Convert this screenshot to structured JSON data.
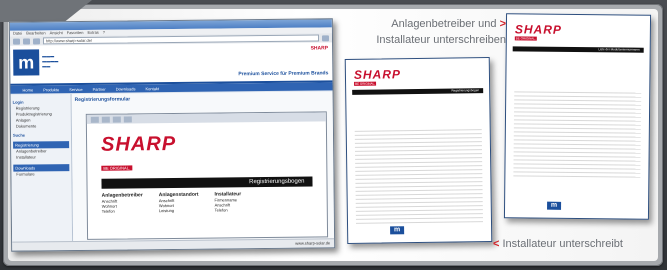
{
  "annotations": {
    "top_line1": "Anlagenbetreiber und",
    "top_arrow": ">",
    "top_line2": "Installateur unterschreiben",
    "bottom_arrow": "<",
    "bottom_text": "Installateur unterschreibt"
  },
  "browser": {
    "menu": [
      "Datei",
      "Bearbeiten",
      "Ansicht",
      "Favoriten",
      "Extras",
      "?"
    ],
    "address": "http://www.sharp-solar.de/",
    "logo_letter": "m",
    "slogan": "Premium Service für Premium Brands",
    "brand_mini": "SHARP",
    "nav": [
      "Home",
      "Produkte",
      "Service",
      "Partner",
      "Downloads",
      "Kontakt"
    ],
    "sidebar": {
      "heading1": "Login",
      "items1": [
        "Registrierung",
        "Produktregistrierung",
        "Anlagen",
        "Dokumente"
      ],
      "heading2": "Suche",
      "box1": "Registrierung",
      "items2": [
        "Anlagenbetreiber",
        "Installateur"
      ],
      "box2": "Downloads",
      "items3": [
        "Formulare"
      ]
    },
    "main_title": "Registrierungsformular",
    "doc": {
      "brand": "SHARP",
      "brand_sub": "BE ORIGINAL.",
      "bar_title": "Registrierungsbogen",
      "col1_head": "Anlagenbetreiber",
      "col1": [
        "Anschrift",
        "Wohnort",
        "Telefon"
      ],
      "col2_head": "Anlagenstandort",
      "col2": [
        "Anschrift",
        "Wohnort",
        "Leistung"
      ],
      "col3_head": "Installateur",
      "col3": [
        "Firmenname",
        "Anschrift",
        "Telefon"
      ]
    },
    "status": "www.sharp-solar.de"
  },
  "page_left": {
    "brand": "SHARP",
    "brand_sub": "BE ORIGINAL.",
    "bar_title": "Registrierungsbogen",
    "footer_logo": "m"
  },
  "page_right": {
    "brand": "SHARP",
    "brand_sub": "BE ORIGINAL.",
    "bar_title": "Liste der Modulseriennummern",
    "footer_logo": "m"
  }
}
